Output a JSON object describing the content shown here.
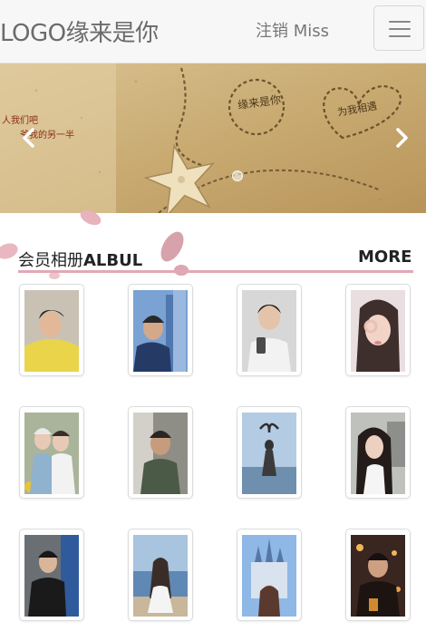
{
  "navbar": {
    "logo": "LOGO缘来是你",
    "user_text": "注销 Miss",
    "menu_icon": "hamburger-menu-icon"
  },
  "banner": {
    "handwriting": [
      "缘来是你",
      "为我相遇",
      "人我们吧",
      "爷我的另一半"
    ],
    "prev_icon": "chevron-left-icon",
    "next_icon": "chevron-right-icon"
  },
  "album": {
    "title_cn": "会员相册",
    "title_en": "ALBUL",
    "more_label": "MORE",
    "photos": [
      {
        "alt": "yellow-shirt-boy"
      },
      {
        "alt": "boy-with-buildings"
      },
      {
        "alt": "boy-taking-selfie"
      },
      {
        "alt": "girl-hand-on-face"
      },
      {
        "alt": "two-girls"
      },
      {
        "alt": "boy-in-car"
      },
      {
        "alt": "girl-heart-sky"
      },
      {
        "alt": "girl-long-hair"
      },
      {
        "alt": "boy-dark-jacket"
      },
      {
        "alt": "girl-by-sea"
      },
      {
        "alt": "girl-castle"
      },
      {
        "alt": "boy-night-lights"
      }
    ]
  }
}
